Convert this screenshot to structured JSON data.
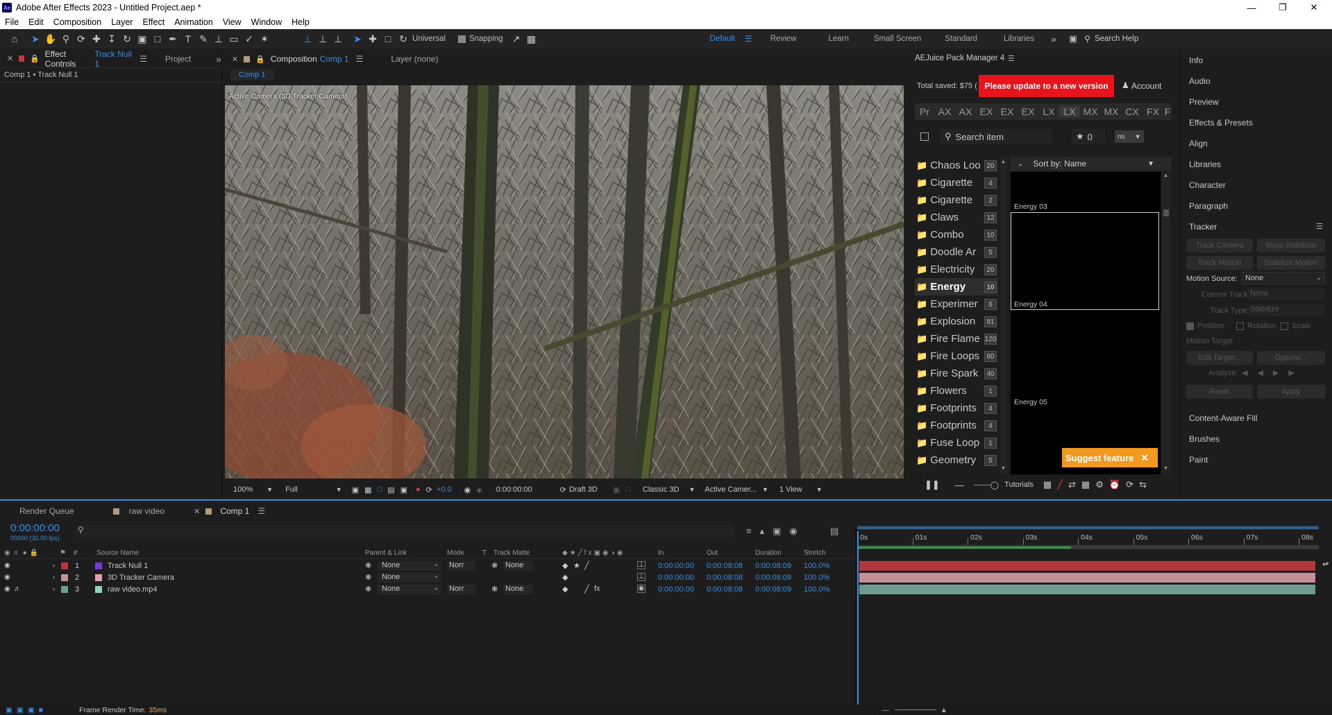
{
  "window": {
    "title": "Adobe After Effects 2023 - Untitled Project.aep *",
    "logo": "Ae"
  },
  "menu": [
    "File",
    "Edit",
    "Composition",
    "Layer",
    "Effect",
    "Animation",
    "View",
    "Window",
    "Help"
  ],
  "toolbar": {
    "universal": "Universal",
    "snapping": "Snapping",
    "workspaces": [
      "Default",
      "Review",
      "Learn",
      "Small Screen",
      "Standard",
      "Libraries"
    ],
    "search_help": "Search Help"
  },
  "effect_controls": {
    "tab_prefix": "Effect Controls",
    "tab_layer": "Track Null 1",
    "project_tab": "Project",
    "breadcrumb": "Comp 1 • Track Null 1"
  },
  "composition": {
    "tab_prefix": "Composition",
    "tab_comp": "Comp 1",
    "layer_tab": "Layer (none)",
    "flow_tab": "Comp 1",
    "camera_label": "Active Camera (3D Tracker Camera)"
  },
  "viewer_bar": {
    "zoom": "100%",
    "resolution": "Full",
    "exposure": "+0.0",
    "time": "0:00:00:00",
    "draft": "Draft 3D",
    "renderer": "Classic 3D",
    "camera": "Active Camer...",
    "views": "1 View"
  },
  "aejuice": {
    "title": "AEJuice Pack Manager 4",
    "total_saved": "Total saved: $75 (",
    "update": "Please update to a new version",
    "account": "Account",
    "tabs": [
      "Pr",
      "AX",
      "AX",
      "EX",
      "EX",
      "EX",
      "LX",
      "LX",
      "MX",
      "MX",
      "CX",
      "FX",
      "F"
    ],
    "search_placeholder": "Search item",
    "stars": "0",
    "ns": "ns",
    "sort": "Sort by: Name",
    "folders": [
      {
        "name": "Chaos Loo",
        "count": "20"
      },
      {
        "name": "Cigarette",
        "count": "4"
      },
      {
        "name": "Cigarette",
        "count": "2"
      },
      {
        "name": "Claws",
        "count": "12"
      },
      {
        "name": "Combo",
        "count": "10"
      },
      {
        "name": "Doodle Ar",
        "count": "5"
      },
      {
        "name": "Electricity",
        "count": "20"
      },
      {
        "name": "Energy",
        "count": "10"
      },
      {
        "name": "Experimer",
        "count": "6"
      },
      {
        "name": "Explosion",
        "count": "81"
      },
      {
        "name": "Fire Flame",
        "count": "120"
      },
      {
        "name": "Fire Loops",
        "count": "60"
      },
      {
        "name": "Fire Spark",
        "count": "40"
      },
      {
        "name": "Flowers",
        "count": "1"
      },
      {
        "name": "Footprints",
        "count": "4"
      },
      {
        "name": "Footprints",
        "count": "4"
      },
      {
        "name": "Fuse Loop",
        "count": "1"
      },
      {
        "name": "Geometry",
        "count": "5"
      }
    ],
    "selected_folder": "Energy",
    "previews": [
      "Energy 03",
      "Energy 04",
      "Energy 05"
    ],
    "suggest": "Suggest feature",
    "tutorials": "Tutorials",
    "colors": {
      "update_bg": "#e8131b",
      "suggest_bg": "#f39a1e",
      "accent": "#3b8de3"
    }
  },
  "right_panels": [
    "Info",
    "Audio",
    "Preview",
    "Effects & Presets",
    "Align",
    "Libraries",
    "Character",
    "Paragraph"
  ],
  "tracker": {
    "title": "Tracker",
    "buttons": [
      "Track Camera",
      "Warp Stabilizer",
      "Track Motion",
      "Stabilize Motion"
    ],
    "motion_source_label": "Motion Source:",
    "motion_source_value": "None",
    "current_track_label": "Current Track:",
    "current_track_value": "None",
    "track_type_label": "Track Type:",
    "track_type_value": "Stabilize",
    "position": "Position",
    "rotation": "Rotation",
    "scale": "Scale",
    "motion_target": "Motion Target",
    "edit_target": "Edit Target...",
    "options": "Options...",
    "analyze": "Analyze:",
    "reset": "Reset",
    "apply": "Apply"
  },
  "bottom_panels": [
    "Content-Aware Fill",
    "Brushes",
    "Paint"
  ],
  "timeline": {
    "tabs": [
      "Render Queue",
      "raw video",
      "Comp 1"
    ],
    "timecode": "0:00:00:00",
    "frame_info": "00000 (30.00 fps)",
    "columns": {
      "num": "#",
      "source": "Source Name",
      "parent": "Parent & Link",
      "mode": "Mode",
      "t": "T",
      "matte": "Track Matte",
      "in": "In",
      "out": "Out",
      "duration": "Duration",
      "stretch": "Stretch"
    },
    "layers": [
      {
        "num": "1",
        "name": "Track Null 1",
        "color": "#b4363d",
        "label_color": "#7a36d8",
        "parent": "None",
        "mode": "Norr",
        "matte": "None",
        "in": "0:00:00:00",
        "out": "0:00:08:08",
        "duration": "0:00:08:09",
        "stretch": "100.0%"
      },
      {
        "num": "2",
        "name": "3D Tracker Camera",
        "color": "#c59096",
        "label_color": "#e0a0b0",
        "parent": "None",
        "mode": "",
        "matte": "",
        "in": "0:00:00:00",
        "out": "0:00:08:08",
        "duration": "0:00:08:09",
        "stretch": "100.0%"
      },
      {
        "num": "3",
        "name": "raw video.mp4",
        "color": "#6f9c91",
        "label_color": "#8fd1c3",
        "parent": "None",
        "mode": "Norr",
        "matte": "None",
        "in": "0:00:00:00",
        "out": "0:00:08:08",
        "duration": "0:00:08:09",
        "stretch": "100.0%"
      }
    ],
    "ruler": [
      "0s",
      "01s",
      "02s",
      "03s",
      "04s",
      "05s",
      "06s",
      "07s",
      "08s"
    ],
    "footer_label": "Frame Render Time:",
    "footer_value": "35ms"
  }
}
